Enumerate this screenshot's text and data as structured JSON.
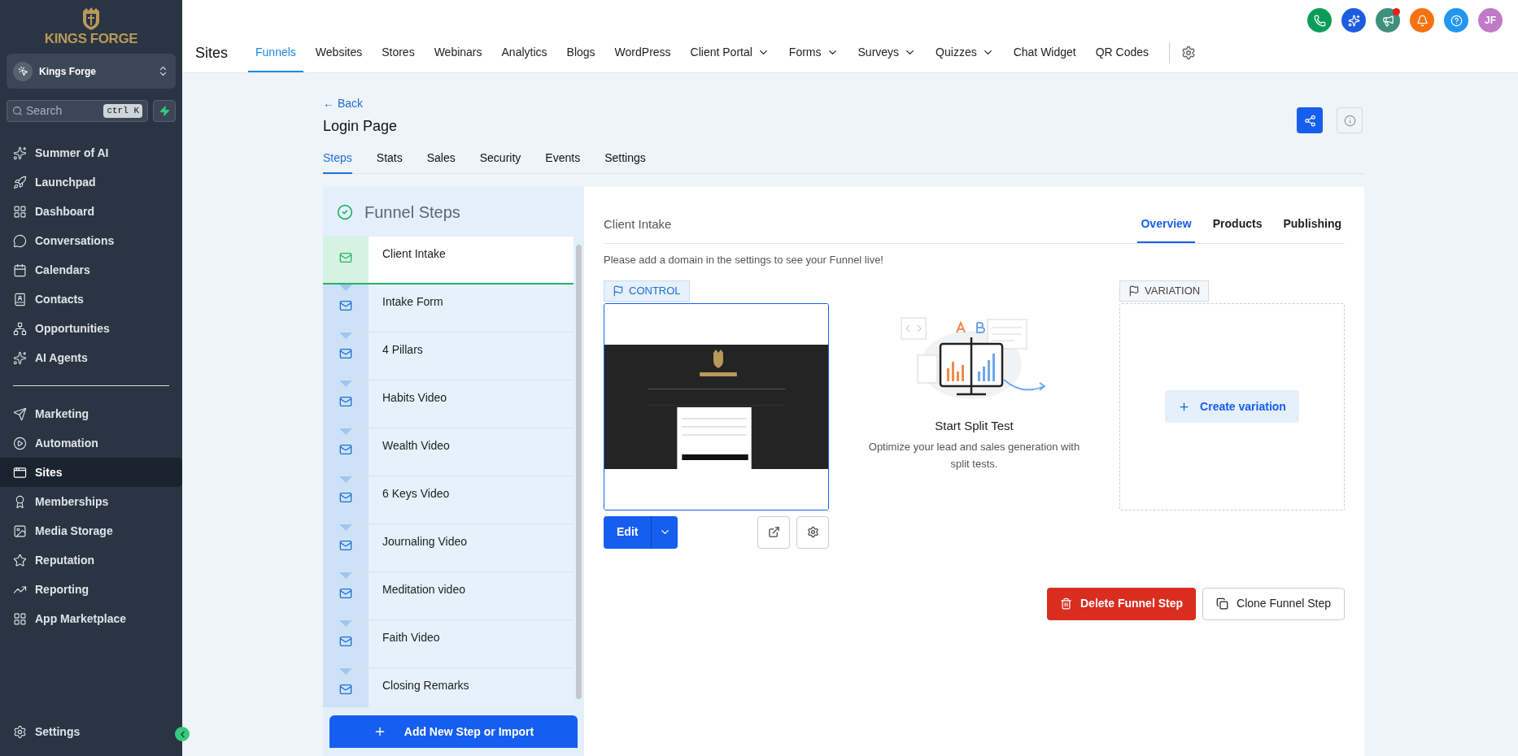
{
  "sidebar": {
    "brand": "KINGS FORGE",
    "account": {
      "name": "Kings Forge"
    },
    "search": {
      "placeholder": "Search",
      "shortcut": "ctrl K"
    },
    "nav_groups": [
      [
        {
          "label": "Summer of AI",
          "selected": false
        },
        {
          "label": "Launchpad",
          "selected": false
        },
        {
          "label": "Dashboard",
          "selected": false
        },
        {
          "label": "Conversations",
          "selected": false
        },
        {
          "label": "Calendars",
          "selected": false
        },
        {
          "label": "Contacts",
          "selected": false
        },
        {
          "label": "Opportunities",
          "selected": false
        },
        {
          "label": "AI Agents",
          "selected": false
        }
      ],
      [
        {
          "label": "Marketing",
          "selected": false
        },
        {
          "label": "Automation",
          "selected": false
        },
        {
          "label": "Sites",
          "selected": true
        },
        {
          "label": "Memberships",
          "selected": false
        },
        {
          "label": "Media Storage",
          "selected": false
        },
        {
          "label": "Reputation",
          "selected": false
        },
        {
          "label": "Reporting",
          "selected": false
        },
        {
          "label": "App Marketplace",
          "selected": false
        }
      ]
    ],
    "settings": "Settings"
  },
  "topbar": {
    "section": "Sites",
    "nav": [
      {
        "label": "Funnels",
        "selected": true,
        "dropdown": false
      },
      {
        "label": "Websites",
        "selected": false,
        "dropdown": false
      },
      {
        "label": "Stores",
        "selected": false,
        "dropdown": false
      },
      {
        "label": "Webinars",
        "selected": false,
        "dropdown": false
      },
      {
        "label": "Analytics",
        "selected": false,
        "dropdown": false
      },
      {
        "label": "Blogs",
        "selected": false,
        "dropdown": false
      },
      {
        "label": "WordPress",
        "selected": false,
        "dropdown": false
      },
      {
        "label": "Client Portal",
        "selected": false,
        "dropdown": true
      },
      {
        "label": "Forms",
        "selected": false,
        "dropdown": true
      },
      {
        "label": "Surveys",
        "selected": false,
        "dropdown": true
      },
      {
        "label": "Quizzes",
        "selected": false,
        "dropdown": true
      },
      {
        "label": "Chat Widget",
        "selected": false,
        "dropdown": false
      },
      {
        "label": "QR Codes",
        "selected": false,
        "dropdown": false
      }
    ],
    "actions": [
      {
        "color": "#0b9d58",
        "badge": false
      },
      {
        "color": "#1d5be0",
        "badge": false
      },
      {
        "color": "#3f8f7d",
        "badge": true
      },
      {
        "color": "#f77311",
        "badge": false
      },
      {
        "color": "#2196f3",
        "badge": false
      }
    ],
    "avatar": {
      "initials": "JF"
    }
  },
  "page": {
    "back": "← Back",
    "title": "Login Page",
    "tabs": [
      {
        "label": "Steps",
        "selected": true
      },
      {
        "label": "Stats",
        "selected": false
      },
      {
        "label": "Sales",
        "selected": false
      },
      {
        "label": "Security",
        "selected": false
      },
      {
        "label": "Events",
        "selected": false
      },
      {
        "label": "Settings",
        "selected": false
      }
    ]
  },
  "funnel_steps": {
    "title": "Funnel Steps",
    "steps": [
      {
        "name": "Client Intake",
        "selected": true
      },
      {
        "name": "Intake Form",
        "selected": false
      },
      {
        "name": "4 Pillars",
        "selected": false
      },
      {
        "name": "Habits Video",
        "selected": false
      },
      {
        "name": "Wealth Video",
        "selected": false
      },
      {
        "name": "6 Keys Video",
        "selected": false
      },
      {
        "name": "Journaling Video",
        "selected": false
      },
      {
        "name": "Meditation video",
        "selected": false
      },
      {
        "name": "Faith Video",
        "selected": false
      },
      {
        "name": "Closing Remarks",
        "selected": false
      }
    ],
    "add_button": "Add New Step or Import"
  },
  "step_detail": {
    "title": "Client Intake",
    "tabs": [
      {
        "label": "Overview",
        "selected": true
      },
      {
        "label": "Products",
        "selected": false
      },
      {
        "label": "Publishing",
        "selected": false
      }
    ],
    "notice": "Please add a domain in the settings to see your Funnel live!",
    "control": {
      "label": "CONTROL",
      "edit": "Edit"
    },
    "split_test": {
      "title": "Start Split Test",
      "description": "Optimize your lead and sales generation with split tests."
    },
    "variation": {
      "label": "VARIATION",
      "create": "Create variation"
    },
    "delete": "Delete Funnel Step",
    "clone": "Clone Funnel Step"
  }
}
